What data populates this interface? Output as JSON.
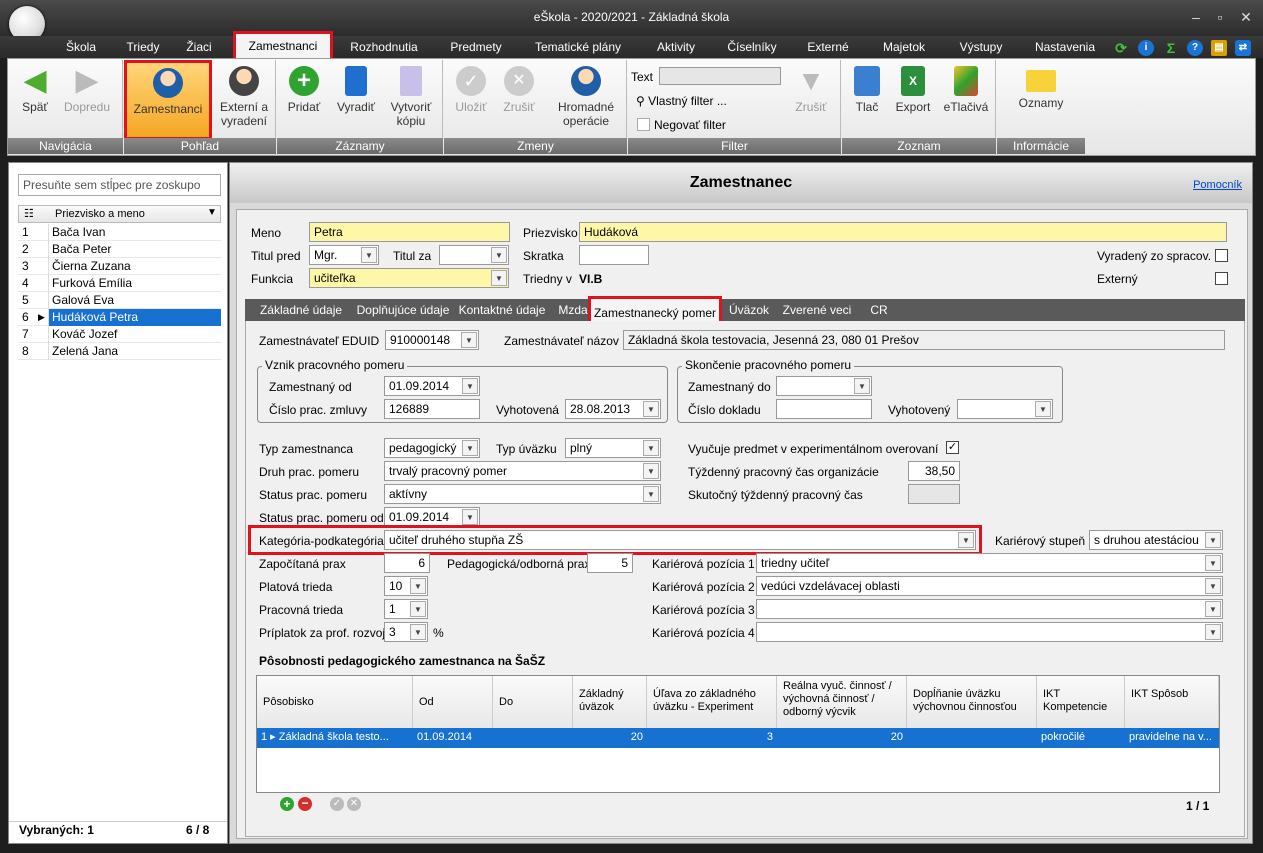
{
  "app": {
    "title": "eŠkola - 2020/2021 - Základná škola"
  },
  "menu": [
    "Škola",
    "Triedy",
    "Žiaci",
    "Zamestnanci",
    "Rozhodnutia",
    "Predmety",
    "Tematické plány",
    "Aktivity",
    "Číselníky",
    "Externé",
    "Majetok",
    "Výstupy",
    "Nastavenia"
  ],
  "ribbon": {
    "groups": [
      "Navigácia",
      "Pohľad",
      "Záznamy",
      "Zmeny",
      "Filter",
      "Zoznam",
      "Informácie"
    ],
    "back": "Späť",
    "forward": "Dopredu",
    "employees": "Zamestnanci",
    "external_line1": "Externí a",
    "external_line2": "vyradení",
    "add": "Pridať",
    "remove": "Vyradiť",
    "copy_line1": "Vytvoriť",
    "copy_line2": "kópiu",
    "save": "Uložiť",
    "cancel": "Zrušiť",
    "bulk_line1": "Hromadné",
    "bulk_line2": "operácie",
    "text_label": "Text",
    "custom_filter": "Vlastný filter ...",
    "negate_filter": "Negovať filter",
    "filter_cancel": "Zrušiť",
    "print": "Tlač",
    "export": "Export",
    "eprint": "eTlačivá",
    "notices": "Oznamy"
  },
  "left": {
    "group_placeholder": "Presuňte sem stĺpec pre zoskupo",
    "column_header": "Priezvisko a meno",
    "rows": [
      {
        "n": "1",
        "name": "Bača Ivan"
      },
      {
        "n": "2",
        "name": "Bača Peter"
      },
      {
        "n": "3",
        "name": "Čierna Zuzana"
      },
      {
        "n": "4",
        "name": "Furková Emília"
      },
      {
        "n": "5",
        "name": "Galová Eva"
      },
      {
        "n": "6",
        "name": "Hudáková Petra"
      },
      {
        "n": "7",
        "name": "Kováč Jozef"
      },
      {
        "n": "8",
        "name": "Zelená Jana"
      }
    ],
    "selected_label": "Vybraných: 1",
    "count": "6 / 8"
  },
  "form": {
    "title": "Zamestnanec",
    "help": "Pomocník",
    "meno_label": "Meno",
    "meno": "Petra",
    "priezvisko_label": "Priezvisko",
    "priezvisko": "Hudáková",
    "titul_pred_label": "Titul pred",
    "titul_pred": "Mgr.",
    "titul_za_label": "Titul za",
    "titul_za": "",
    "skratka_label": "Skratka",
    "skratka": "",
    "vyradeny_label": "Vyradený zo spracov.",
    "funkcia_label": "Funkcia",
    "funkcia": "učiteľka",
    "triedny_label": "Triedny v",
    "triedny": "VI.B",
    "externy_label": "Externý"
  },
  "tabs": [
    "Základné údaje",
    "Doplňujúce údaje",
    "Kontaktné údaje",
    "Mzda",
    "Zamestnanecký pomer",
    "Úväzok",
    "Zverené veci",
    "CR"
  ],
  "employment": {
    "edu_label": "Zamestnávateľ EDUID",
    "edu": "910000148",
    "name_label": "Zamestnávateľ názov",
    "name": "Základná škola testovacia, Jesenná 23, 080 01 Prešov",
    "vznik_legend": "Vznik pracovného pomeru",
    "od_label": "Zamestnaný od",
    "od": "01.09.2014",
    "zmluva_label": "Číslo prac. zmluvy",
    "zmluva": "126889",
    "vyhot_label": "Vyhotovená",
    "vyhot": "28.08.2013",
    "skon_legend": "Skončenie pracovného pomeru",
    "do_label": "Zamestnaný do",
    "do": "",
    "doklad_label": "Číslo dokladu",
    "doklad": "",
    "vyhot2_label": "Vyhotovený",
    "vyhot2": "",
    "typ_label": "Typ zamestnanca",
    "typ": "pedagogický",
    "uv_label": "Typ úväzku",
    "uv": "plný",
    "druh_label": "Druh prac. pomeru",
    "druh": "trvalý pracovný pomer",
    "status_label": "Status prac. pomeru",
    "status": "aktívny",
    "status_od_label": "Status prac. pomeru od",
    "status_od": "01.09.2014",
    "kat_label": "Kategória-podkategória",
    "kat": "učiteľ druhého stupňa ZŠ",
    "exp_label": "Vyučuje predmet v experimentálnom overovaní",
    "tyz_label": "Týždenný pracovný čas organizácie",
    "tyz": "38,50",
    "skut_label": "Skutočný týždenný pracovný čas",
    "skut": "",
    "kar_label": "Kariérový stupeň",
    "kar": "s druhou atestáciou",
    "prax_label": "Započítaná prax",
    "prax": "6",
    "ped_label": "Pedagogická/odborná prax",
    "ped": "5",
    "plat_label": "Platová trieda",
    "plat": "10",
    "prac_label": "Pracovná trieda",
    "prac": "1",
    "prip_label": "Príplatok za prof. rozvoj",
    "prip": "3",
    "pct": "%",
    "kp1_label": "Kariérová pozícia 1",
    "kp1": "triedny učiteľ",
    "kp2_label": "Kariérová pozícia 2",
    "kp2": "vedúci vzdelávacej oblasti",
    "kp3_label": "Kariérová pozícia 3",
    "kp3": "",
    "kp4_label": "Kariérová pozícia 4",
    "kp4": ""
  },
  "grid": {
    "title": "Pôsobnosti pedagogického zamestnanca na ŠaŠZ",
    "headers": [
      "Pôsobisko",
      "Od",
      "Do",
      "Základný úväzok",
      "Úľava zo základného úväzku - Experiment",
      "Reálna vyuč. činnosť / výchovná činnosť / odborný výcvik",
      "Dopĺňanie úväzku výchovnou činnosťou",
      "IKT Kompetencie",
      "IKT Spôsob"
    ],
    "row": {
      "n": "1",
      "posobisko": "Základná škola testo...",
      "od": "01.09.2014",
      "do": "",
      "zakl": "20",
      "ulava": "3",
      "realna": "20",
      "dopl": "",
      "ikt_k": "pokročilé",
      "ikt_s": "pravidelne na v..."
    },
    "pager": "1 / 1"
  }
}
